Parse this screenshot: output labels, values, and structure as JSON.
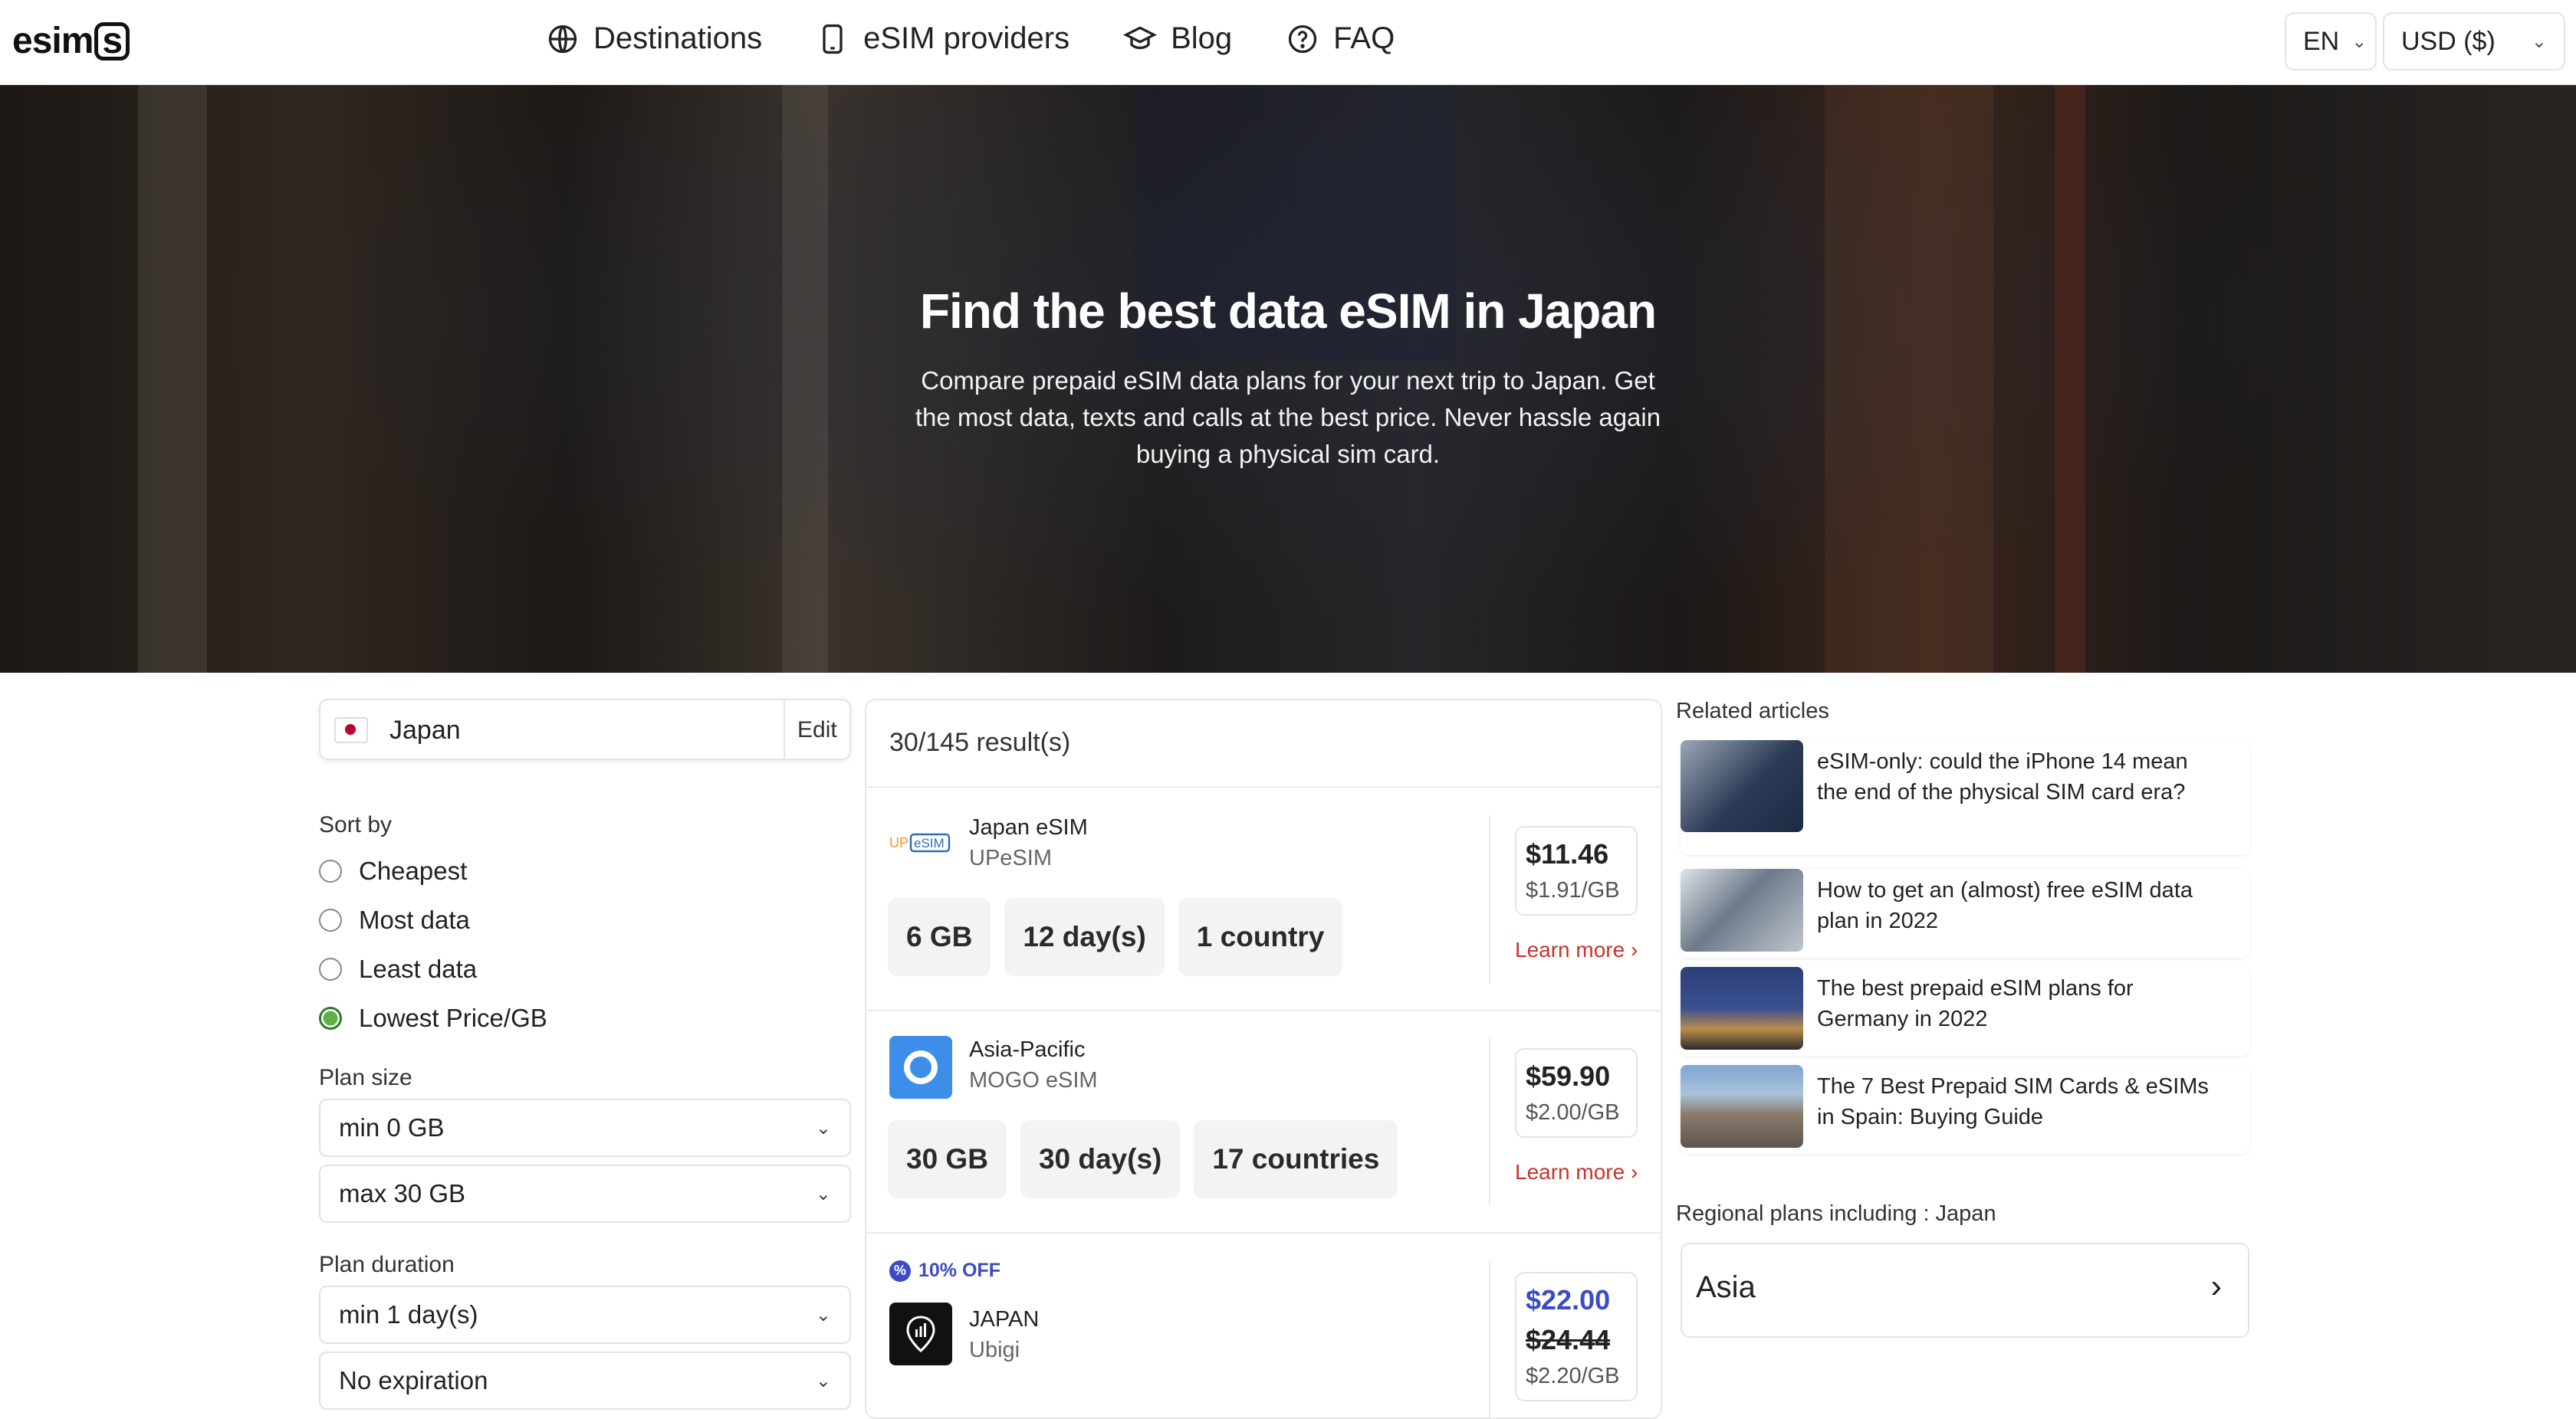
{
  "header": {
    "logo": "esim",
    "logo_box": "s",
    "nav": [
      {
        "label": "Destinations",
        "icon": "globe-icon"
      },
      {
        "label": "eSIM providers",
        "icon": "phone-icon"
      },
      {
        "label": "Blog",
        "icon": "graduation-cap-icon"
      },
      {
        "label": "FAQ",
        "icon": "question-circle-icon"
      }
    ],
    "language": "EN",
    "currency": "USD ($)"
  },
  "hero": {
    "title": "Find the best data eSIM in Japan",
    "subtitle": "Compare prepaid eSIM data plans for your next trip to Japan. Get the most data, texts and calls at the best price. Never hassle again buying a physical sim card."
  },
  "filters": {
    "country": "Japan",
    "edit_label": "Edit",
    "sort_label": "Sort by",
    "sort_options": [
      "Cheapest",
      "Most data",
      "Least data",
      "Lowest Price/GB"
    ],
    "sort_selected": "Lowest Price/GB",
    "plan_size_label": "Plan size",
    "plan_size_min": "min 0 GB",
    "plan_size_max": "max 30 GB",
    "plan_duration_label": "Plan duration",
    "plan_duration_min": "min 1 day(s)",
    "plan_expiration": "No expiration"
  },
  "results": {
    "count": "30/145 result(s)",
    "learn_more": "Learn more ›",
    "plans": [
      {
        "name": "Japan eSIM",
        "provider": "UPeSIM",
        "data": "6 GB",
        "days": "12 day(s)",
        "coverage": "1 country",
        "price": "$11.46",
        "per_gb": "$1.91/GB"
      },
      {
        "name": "Asia-Pacific",
        "provider": "MOGO eSIM",
        "data": "30 GB",
        "days": "30 day(s)",
        "coverage": "17 countries",
        "price": "$59.90",
        "per_gb": "$2.00/GB"
      },
      {
        "name": "JAPAN",
        "provider": "Ubigi",
        "discount": "10% OFF",
        "price": "$22.00",
        "old_price": "$24.44",
        "per_gb": "$2.20/GB"
      }
    ]
  },
  "related": {
    "title": "Related articles",
    "articles": [
      "eSIM-only: could the iPhone 14 mean the end of the physical SIM card era?",
      "How to get an (almost) free eSIM data plan in 2022",
      "The best prepaid eSIM plans for Germany in 2022",
      "The 7 Best Prepaid SIM Cards & eSIMs in Spain: Buying Guide"
    ]
  },
  "regional": {
    "title": "Regional plans including : Japan",
    "region": "Asia"
  },
  "colors": {
    "accent_red": "#c9332b",
    "discount_blue": "#3b4bc7",
    "radio_green": "#5fae4b"
  }
}
